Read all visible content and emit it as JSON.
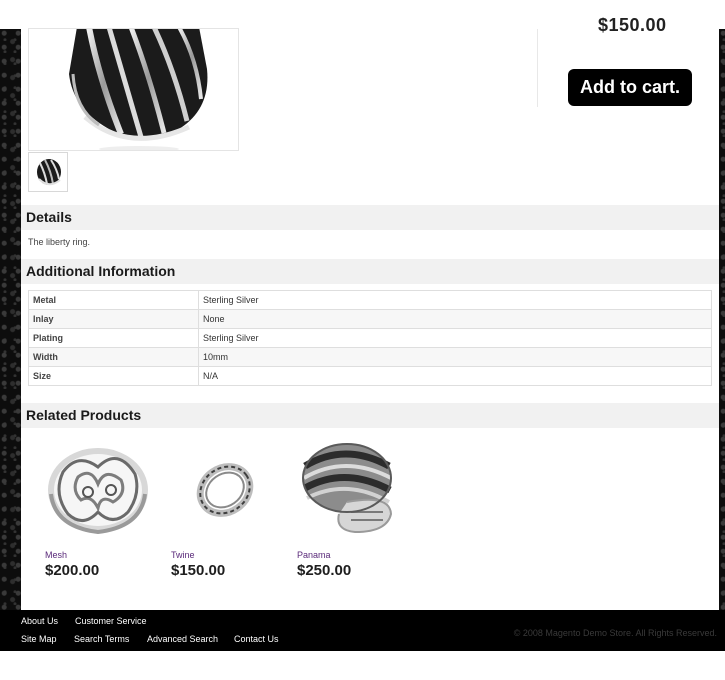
{
  "product": {
    "price_partial": "$150.00",
    "add_to_cart_label": "Add to cart."
  },
  "details": {
    "title": "Details",
    "text": "The liberty ring."
  },
  "additional": {
    "title": "Additional Information",
    "rows": [
      {
        "label": "Metal",
        "value": "Sterling Silver"
      },
      {
        "label": "Inlay",
        "value": "None"
      },
      {
        "label": "Plating",
        "value": "Sterling Silver"
      },
      {
        "label": "Width",
        "value": "10mm"
      },
      {
        "label": "Size",
        "value": "N/A"
      }
    ]
  },
  "related": {
    "title": "Related Products",
    "items": [
      {
        "name": "Mesh",
        "price": "$200.00"
      },
      {
        "name": "Twine",
        "price": "$150.00"
      },
      {
        "name": "Panama",
        "price": "$250.00"
      }
    ]
  },
  "footer": {
    "links": [
      "About Us",
      "Customer Service",
      "Site Map",
      "Search Terms",
      "Advanced Search",
      "Contact Us"
    ],
    "copyright": "© 2008 Magento Demo Store. All Rights Reserved."
  }
}
